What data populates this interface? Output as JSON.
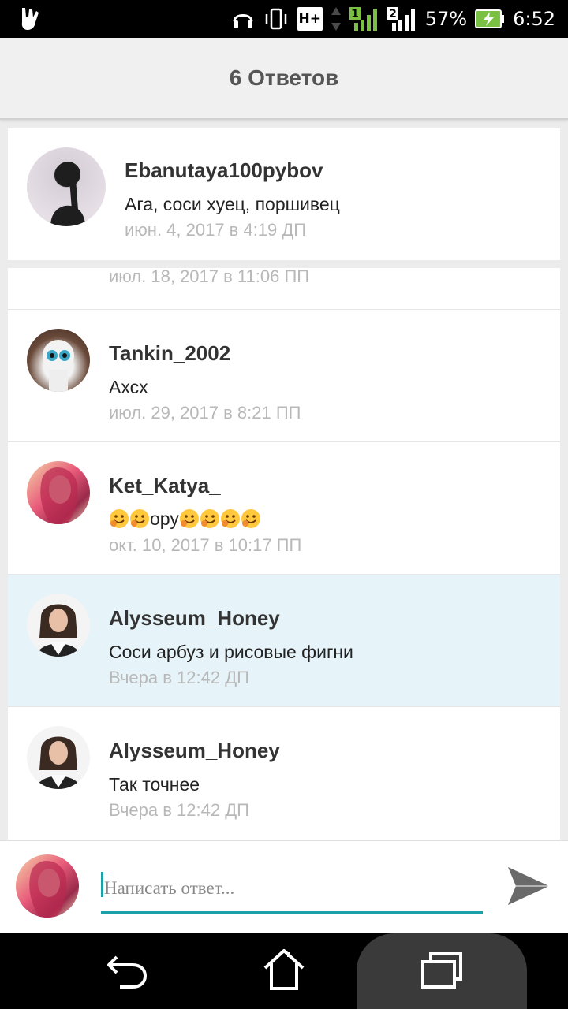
{
  "status_bar": {
    "battery_percent": "57%",
    "time": "6:52",
    "network_type": "H+",
    "sim2_label": "2",
    "sim1_label": "1",
    "icons": [
      "hand-horns-icon",
      "headphones-icon",
      "vibrate-icon",
      "signal-icon",
      "battery-charging-icon"
    ]
  },
  "header": {
    "title": "6 Ответов"
  },
  "parent_comment": {
    "username": "Ebanutaya100pybov",
    "message": "Ага, соси хуец, поршивец",
    "timestamp": "июн. 4, 2017 в 4:19 ДП"
  },
  "replies": [
    {
      "username": "",
      "message": "",
      "timestamp": "июл. 18, 2017 в 11:06 ПП"
    },
    {
      "username": "Tankin_2002",
      "message": "Ахсх",
      "timestamp": "июл. 29, 2017 в 8:21 ПП"
    },
    {
      "username": "Ket_Katya_",
      "message_text": "ору",
      "timestamp": "окт. 10, 2017 в 10:17 ПП"
    },
    {
      "username": "Alysseum_Honey",
      "message": "Соси арбуз и рисовые фигни",
      "timestamp": "Вчера в 12:42 ДП",
      "highlighted": true
    },
    {
      "username": "Alysseum_Honey",
      "message": "Так точнее",
      "timestamp": "Вчера в 12:42 ДП"
    }
  ],
  "reply_box": {
    "placeholder": "Написать ответ...",
    "accent_color": "#1aa0a8"
  },
  "nav": {
    "icons": [
      "back-icon",
      "home-icon",
      "recents-icon"
    ]
  },
  "colors": {
    "highlight_row": "#e6f4fa",
    "timestamp": "#b8b8b8",
    "title": "#555555"
  }
}
